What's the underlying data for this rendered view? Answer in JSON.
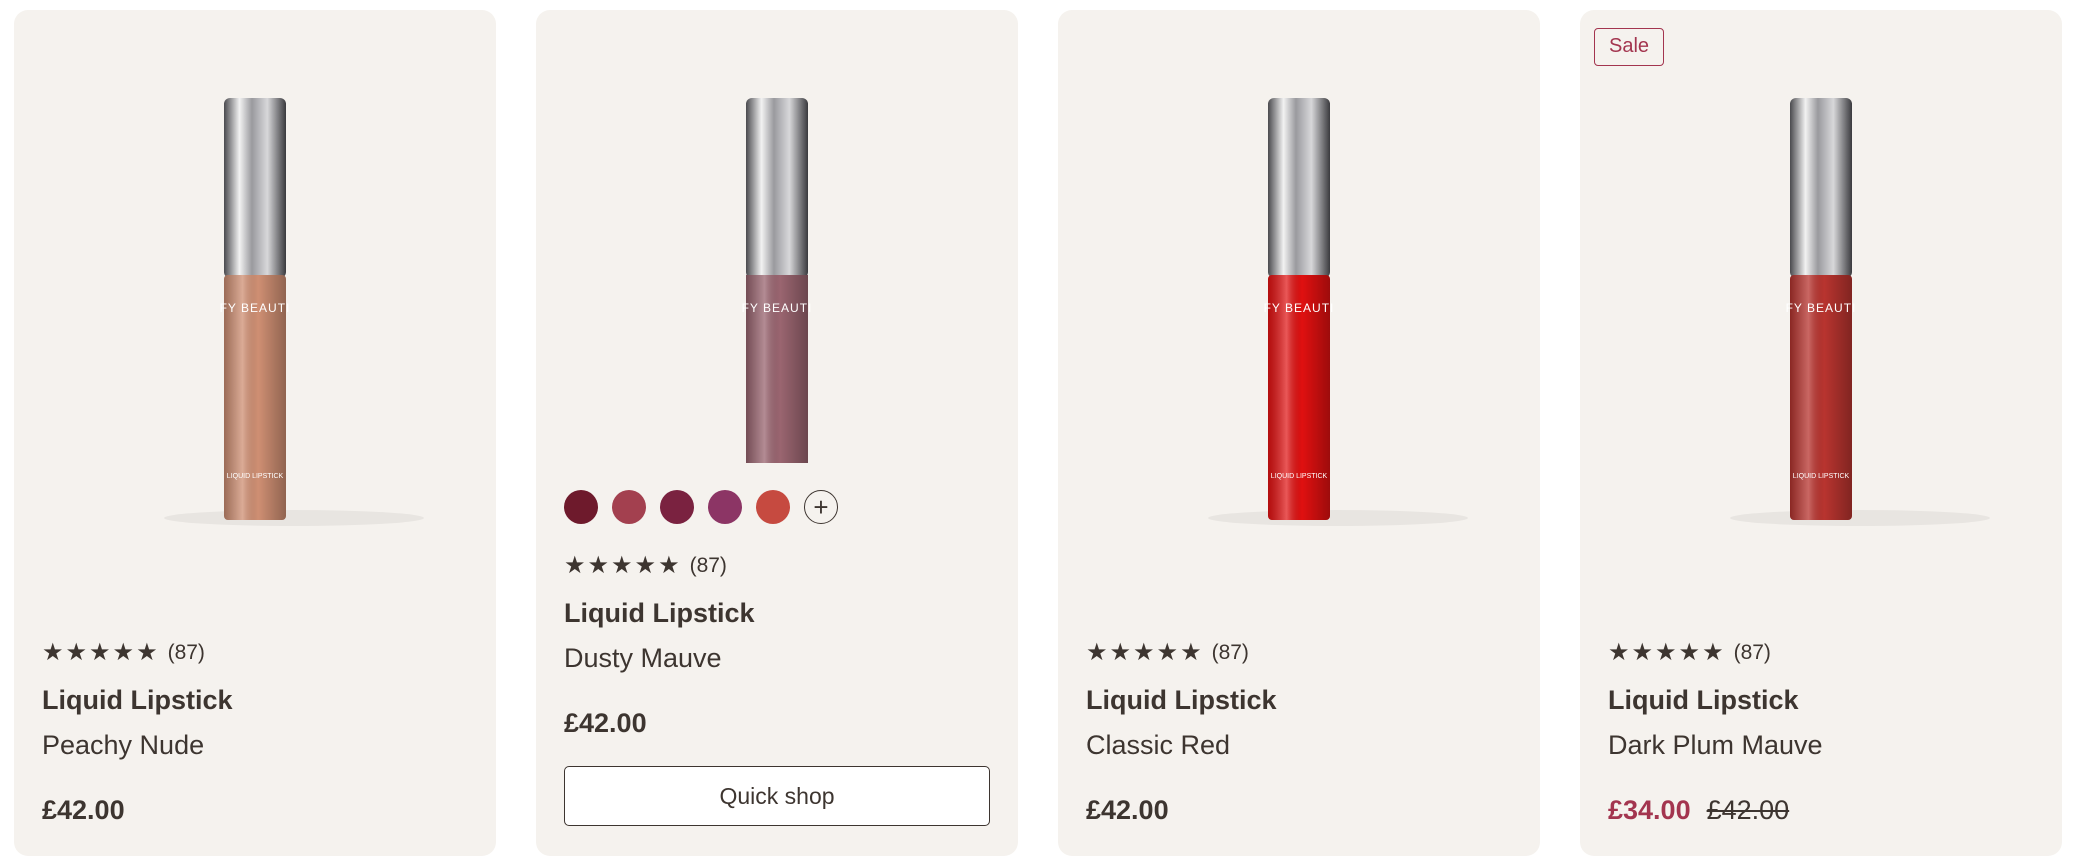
{
  "products": [
    {
      "rating_stars": "★★★★★",
      "review_count": "(87)",
      "title": "Liquid Lipstick",
      "shade": "Peachy Nude",
      "price": "£42.00",
      "color": "#cf8f73",
      "brand_text": "FY BEAUTI",
      "label_text": "LIQUID LIPSTICK"
    },
    {
      "rating_stars": "★★★★★",
      "review_count": "(87)",
      "title": "Liquid Lipstick",
      "shade": "Dusty Mauve",
      "price": "£42.00",
      "color": "#9a6570",
      "brand_text": "FY BEAUTI",
      "swatches": [
        "#6e1a2c",
        "#a3404f",
        "#7a2240",
        "#8c3565",
        "#c64a40"
      ],
      "quick_shop_label": "Quick shop"
    },
    {
      "rating_stars": "★★★★★",
      "review_count": "(87)",
      "title": "Liquid Lipstick",
      "shade": "Classic Red",
      "price": "£42.00",
      "color": "#e01010",
      "brand_text": "FY BEAUTI",
      "label_text": "LIQUID LIPSTICK"
    },
    {
      "sale_badge": "Sale",
      "rating_stars": "★★★★★",
      "review_count": "(87)",
      "title": "Liquid Lipstick",
      "shade": "Dark Plum Mauve",
      "sale_price": "£34.00",
      "original_price": "£42.00",
      "color": "#b8342f",
      "brand_text": "FY BEAUTI",
      "label_text": "LIQUID LIPSTICK"
    }
  ],
  "colors": {
    "card_bg": "#f5f2ee",
    "text": "#3d3530",
    "sale_accent": "#a3354f"
  }
}
